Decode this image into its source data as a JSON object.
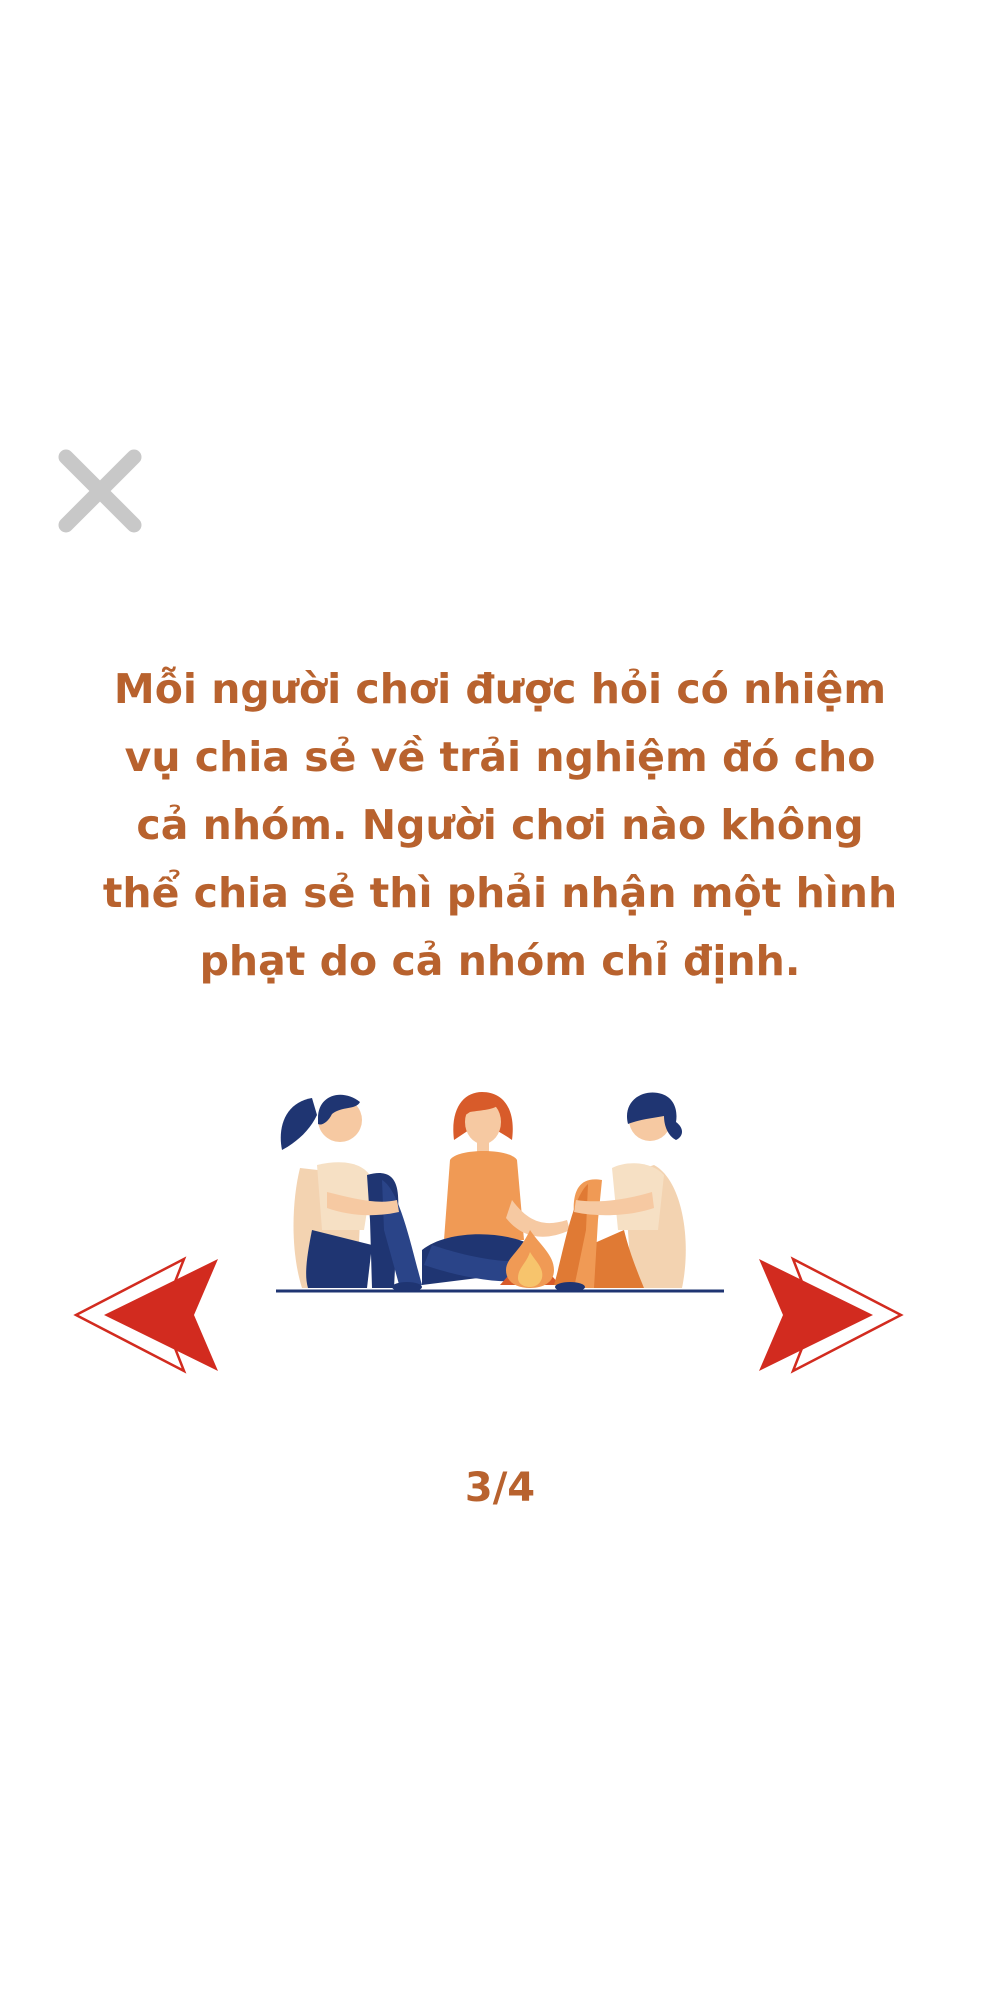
{
  "close_button": {
    "icon": "close-icon",
    "color": "#c8c8c8"
  },
  "instruction": {
    "text": "Mỗi người chơi được hỏi có nhiệm vụ chia sẻ về trải nghiệm đó cho cả nhóm. Người chơi nào không thể chia sẻ thì phải nhận một hình phạt do cả nhóm chỉ định."
  },
  "illustration": {
    "icon": "friends-campfire-illustration"
  },
  "navigation": {
    "prev_icon": "arrow-left-icon",
    "next_icon": "arrow-right-icon",
    "arrow_color": "#d22b1f"
  },
  "pager": {
    "text": "3/4"
  },
  "colors": {
    "text_accent": "#b8622e",
    "navy": "#1f3572",
    "orange": "#f09a55",
    "dark_orange": "#e07a34",
    "skin": "#f6c9a2",
    "cream": "#f3d3b1"
  }
}
